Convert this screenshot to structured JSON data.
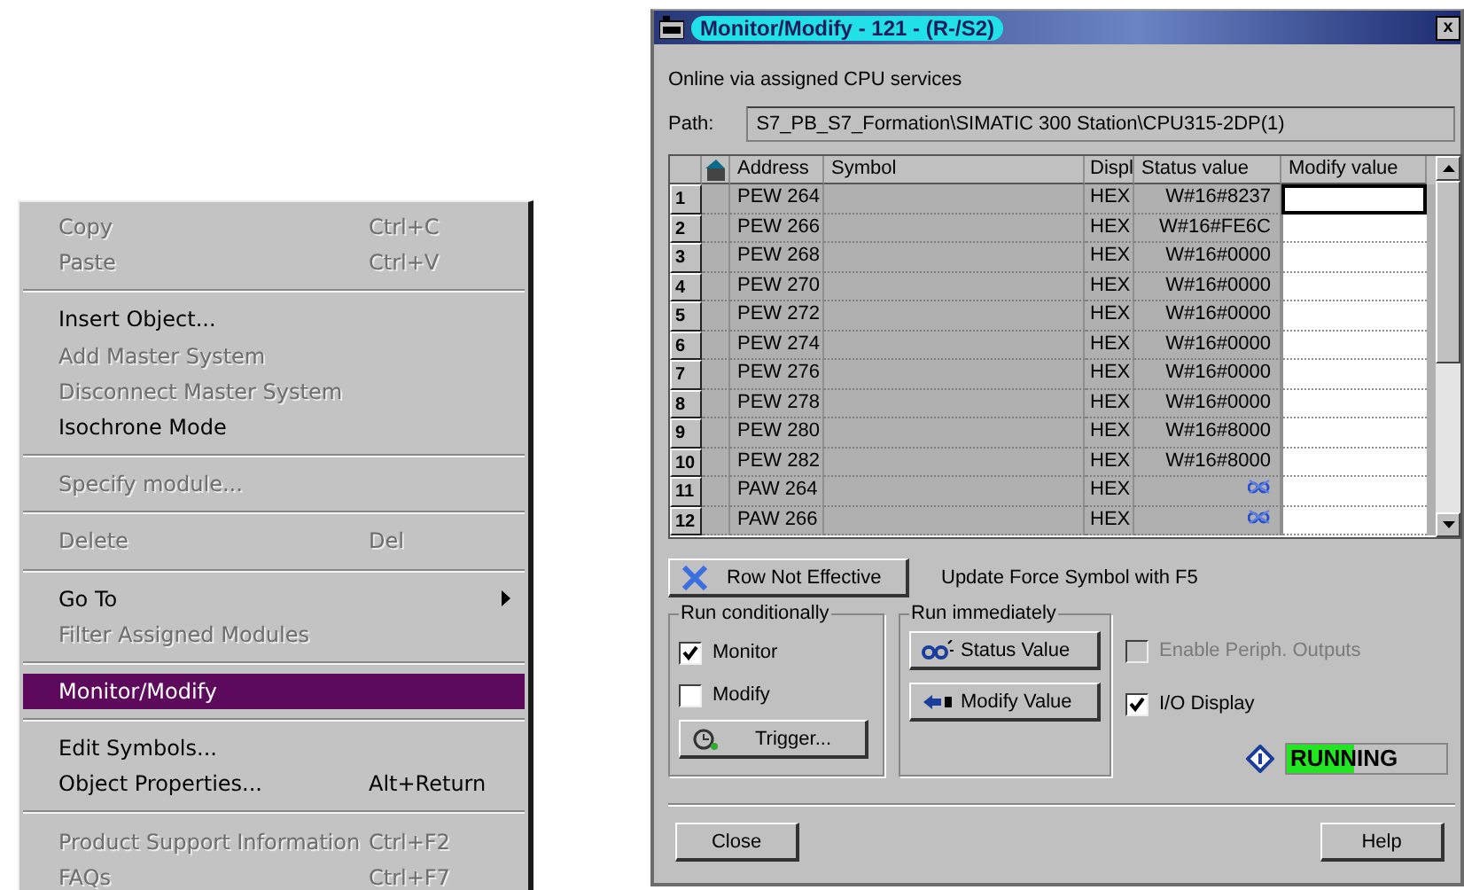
{
  "context_menu": {
    "items": [
      {
        "kind": "item",
        "label": "Copy",
        "shortcut": "Ctrl+C",
        "disabled": true,
        "selected": false,
        "submenu": false
      },
      {
        "kind": "item",
        "label": "Paste",
        "shortcut": "Ctrl+V",
        "disabled": true,
        "selected": false,
        "submenu": false
      },
      {
        "kind": "separator"
      },
      {
        "kind": "item",
        "label": "Insert Object...",
        "disabled": false,
        "selected": false,
        "submenu": false
      },
      {
        "kind": "item",
        "label": "Add Master System",
        "disabled": true,
        "selected": false,
        "submenu": false
      },
      {
        "kind": "item",
        "label": "Disconnect Master System",
        "disabled": true,
        "selected": false,
        "submenu": false
      },
      {
        "kind": "item",
        "label": "Isochrone Mode",
        "disabled": false,
        "selected": false,
        "submenu": false
      },
      {
        "kind": "separator"
      },
      {
        "kind": "item",
        "label": "Specify module...",
        "disabled": true,
        "selected": false,
        "submenu": false
      },
      {
        "kind": "separator"
      },
      {
        "kind": "item",
        "label": "Delete",
        "shortcut": "Del",
        "disabled": true,
        "selected": false,
        "submenu": false
      },
      {
        "kind": "separator"
      },
      {
        "kind": "item",
        "label": "Go To",
        "disabled": false,
        "selected": false,
        "submenu": true
      },
      {
        "kind": "item",
        "label": "Filter Assigned Modules",
        "disabled": true,
        "selected": false,
        "submenu": false
      },
      {
        "kind": "separator"
      },
      {
        "kind": "item",
        "label": "Monitor/Modify",
        "disabled": false,
        "selected": true,
        "submenu": false
      },
      {
        "kind": "separator"
      },
      {
        "kind": "item",
        "label": "Edit Symbols...",
        "disabled": false,
        "selected": false,
        "submenu": false
      },
      {
        "kind": "item",
        "label": "Object Properties...",
        "shortcut": "Alt+Return",
        "disabled": false,
        "selected": false,
        "submenu": false
      },
      {
        "kind": "separator"
      },
      {
        "kind": "item",
        "label": "Product Support Information",
        "shortcut": "Ctrl+F2",
        "disabled": true,
        "selected": false,
        "submenu": false
      },
      {
        "kind": "item",
        "label": "FAQs",
        "shortcut": "Ctrl+F7",
        "disabled": true,
        "selected": false,
        "submenu": false
      }
    ]
  },
  "dialog": {
    "title": "Monitor/Modify - 121 - (R-/S2)",
    "close": "x",
    "online_text": "Online via assigned CPU services",
    "path_label": "Path:",
    "path_value": "S7_PB_S7_Formation\\SIMATIC 300 Station\\CPU315-2DP(1)",
    "table": {
      "columns": [
        "Address",
        "Symbol",
        "Displ",
        "Status value",
        "Modify value"
      ],
      "rows": [
        {
          "number": "1",
          "address": "PEW  264",
          "display": "HEX",
          "kind": "value",
          "status": "W#16#8237",
          "selected": true
        },
        {
          "number": "2",
          "address": "PEW  266",
          "display": "HEX",
          "kind": "value",
          "status": "W#16#FE6C",
          "selected": false
        },
        {
          "number": "3",
          "address": "PEW  268",
          "display": "HEX",
          "kind": "value",
          "status": "W#16#0000",
          "selected": false
        },
        {
          "number": "4",
          "address": "PEW  270",
          "display": "HEX",
          "kind": "value",
          "status": "W#16#0000",
          "selected": false
        },
        {
          "number": "5",
          "address": "PEW  272",
          "display": "HEX",
          "kind": "value",
          "status": "W#16#0000",
          "selected": false
        },
        {
          "number": "6",
          "address": "PEW  274",
          "display": "HEX",
          "kind": "value",
          "status": "W#16#0000",
          "selected": false
        },
        {
          "number": "7",
          "address": "PEW  276",
          "display": "HEX",
          "kind": "value",
          "status": "W#16#0000",
          "selected": false
        },
        {
          "number": "8",
          "address": "PEW  278",
          "display": "HEX",
          "kind": "value",
          "status": "W#16#0000",
          "selected": false
        },
        {
          "number": "9",
          "address": "PEW  280",
          "display": "HEX",
          "kind": "value",
          "status": "W#16#8000",
          "selected": false
        },
        {
          "number": "10",
          "address": "PEW  282",
          "display": "HEX",
          "kind": "value",
          "status": "W#16#8000",
          "selected": false
        },
        {
          "number": "11",
          "address": "PAW  264",
          "display": "HEX",
          "kind": "not_monitored",
          "selected": false
        },
        {
          "number": "12",
          "address": "PAW  266",
          "display": "HEX",
          "kind": "not_monitored",
          "selected": false
        }
      ]
    },
    "row_button": "Row Not Effective",
    "force_hint": "Update Force Symbol with F5",
    "run_conditionally": {
      "title": "Run conditionally",
      "options": [
        {
          "label": "Monitor",
          "checked": true
        },
        {
          "label": "Modify",
          "checked": false
        }
      ],
      "trigger": "Trigger..."
    },
    "run_immediately": {
      "title": "Run immediately",
      "buttons": [
        {
          "kind": "status",
          "label": "Status Value"
        },
        {
          "kind": "modify",
          "label": "Modify Value"
        }
      ]
    },
    "options": [
      {
        "label": "Enable Periph. Outputs",
        "checked": false,
        "disabled": true
      },
      {
        "label": "I/O Display",
        "checked": true,
        "disabled": false
      }
    ],
    "status": {
      "text": "RUNNING",
      "level": 0.42
    },
    "buttons": [
      "Close",
      "Help"
    ]
  }
}
